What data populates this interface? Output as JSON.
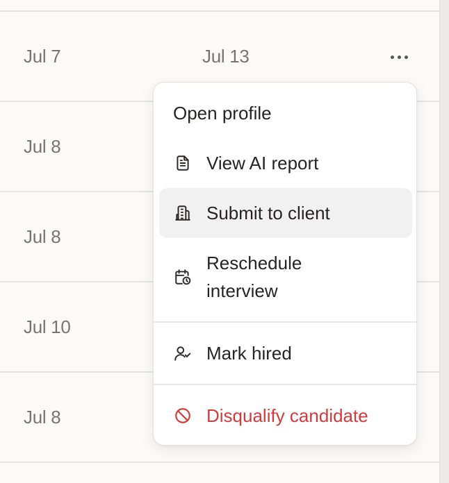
{
  "rows": [
    {
      "col1": "Jul 7",
      "col2": "Jul 13"
    },
    {
      "col1": "Jul 8",
      "col2": ""
    },
    {
      "col1": "Jul 8",
      "col2": ""
    },
    {
      "col1": "Jul 10",
      "col2": ""
    },
    {
      "col1": "Jul 8",
      "col2": ""
    }
  ],
  "menu": {
    "open_profile": "Open profile",
    "view_ai_report": "View AI report",
    "submit_to_client": "Submit to client",
    "reschedule_line1": "Reschedule",
    "reschedule_line2": "interview",
    "mark_hired": "Mark hired",
    "disqualify": "Disqualify candidate"
  },
  "icons": {
    "view_ai_report": "document-icon",
    "submit_to_client": "building-icon",
    "reschedule": "calendar-clock-icon",
    "mark_hired": "user-check-icon",
    "disqualify": "ban-icon",
    "more": "more-horizontal-icon"
  },
  "colors": {
    "danger": "#d33b3b",
    "highlight": "#f2f1f1"
  }
}
